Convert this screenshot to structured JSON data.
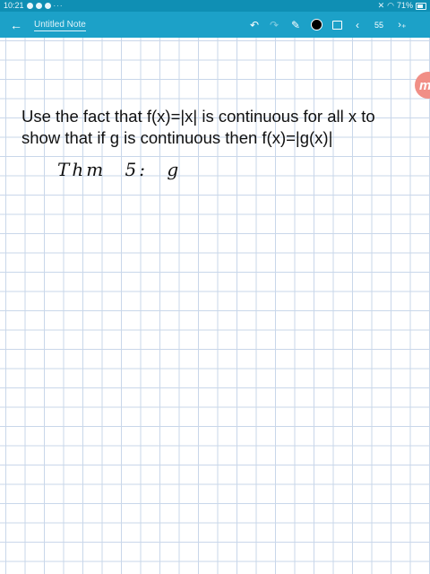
{
  "status_bar": {
    "time": "10:21",
    "battery": "71%"
  },
  "toolbar": {
    "title": "Untitled Note",
    "page_number": "55",
    "back_icon": "←",
    "undo_icon": "↶",
    "redo_icon": "↷",
    "pen_icon": "✎",
    "prev_icon": "‹",
    "next_icon": "›₊",
    "pen_color": "#000000"
  },
  "note": {
    "line_1": "Use the fact that f(x)=|x| is continuous for all x to",
    "line_2": "show that if g is continuous then f(x)=|g(x)|",
    "handwriting": {
      "part_1": "Thm",
      "part_2": "5:",
      "part_3": "g"
    }
  },
  "badge": {
    "label": "m"
  },
  "colors": {
    "toolbar": "#1ca1c8",
    "status_bar": "#0f8fb4",
    "grid": "#c9d7ea",
    "badge": "#f18f86"
  }
}
